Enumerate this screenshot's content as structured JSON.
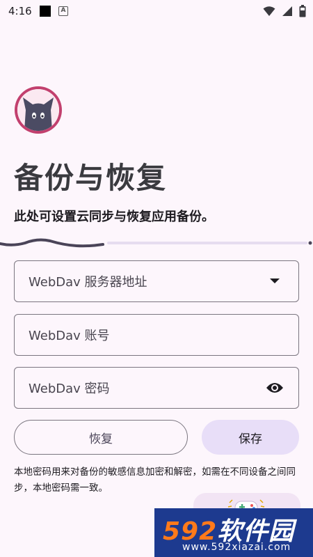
{
  "status_bar": {
    "time": "4:16"
  },
  "page": {
    "title": "备份与恢复",
    "subtitle": "此处可设置云同步与恢复应用备份。",
    "step_progress": 0.33
  },
  "form": {
    "server_field": {
      "placeholder": "WebDav 服务器地址",
      "icon": "dropdown-arrow-icon"
    },
    "account_field": {
      "placeholder": "WebDav 账号"
    },
    "password_field": {
      "placeholder": "WebDav 密码",
      "icon": "eye-icon"
    }
  },
  "actions": {
    "restore_label": "恢复",
    "save_label": "保存"
  },
  "note": "本地密码用来对备份的敏感信息加密和解密，如需在不同设备之间同步，本地密码需一致。",
  "watermark": {
    "logo_number": "592",
    "logo_text": "软件园",
    "url": "www.592xiazai.com"
  },
  "colors": {
    "background": "#fdf6fc",
    "avatar_ring": "#c2406e",
    "save_button": "#e8def8",
    "progress_active": "#4a4458",
    "progress_track": "#e6dcf0"
  }
}
